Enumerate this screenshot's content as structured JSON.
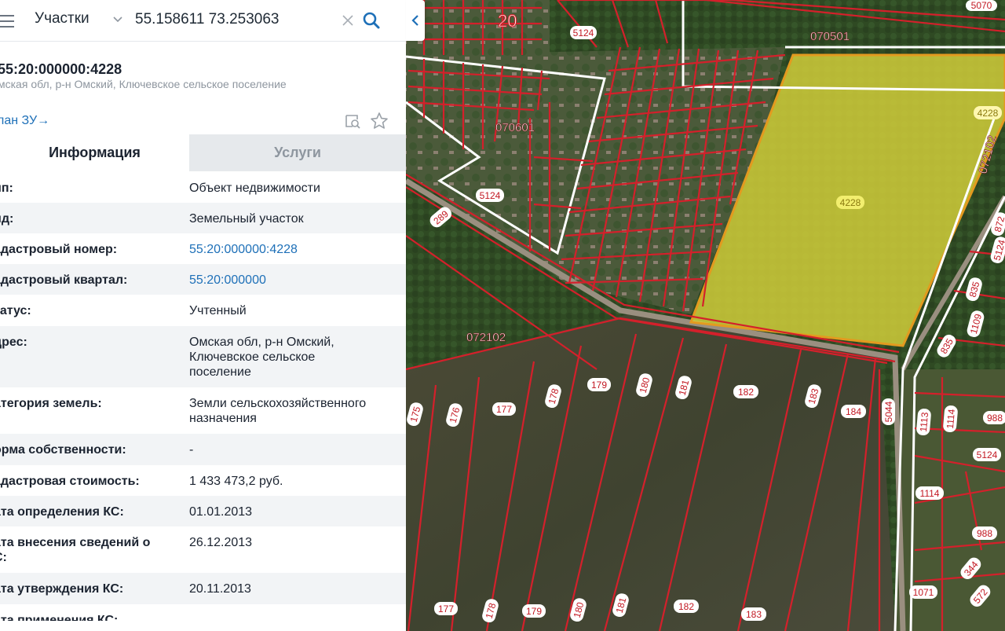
{
  "search": {
    "layer_label": "Участки",
    "query": "55.158611 73.253063"
  },
  "parcel": {
    "number": "55:20:000000:4228",
    "address_short": "мская обл, р-н Омский, Ключевское сельское поселение",
    "plan_link": "лан ЗУ→"
  },
  "tabs": [
    {
      "label": "Информация",
      "active": true
    },
    {
      "label": "Услуги",
      "active": false
    }
  ],
  "info": [
    {
      "key": "ип:",
      "value": [
        "Объект недвижимости"
      ],
      "link": false
    },
    {
      "key": "ид:",
      "value": [
        "Земельный участок"
      ],
      "link": false
    },
    {
      "key": "адастровый номер:",
      "value": [
        "55:20:000000:4228"
      ],
      "link": true
    },
    {
      "key": "адастровый квартал:",
      "value": [
        "55:20:000000"
      ],
      "link": true
    },
    {
      "key": "татус:",
      "value": [
        "Учтенный"
      ],
      "link": false
    },
    {
      "key": "дрес:",
      "value": [
        "Омская обл, р-н Омский,",
        "Ключевское сельское",
        "поселение"
      ],
      "link": false
    },
    {
      "key": "атегория земель:",
      "value": [
        "Земли сельскохозяйственного",
        "назначения"
      ],
      "link": false
    },
    {
      "key": "орма собственности:",
      "value": [
        "-"
      ],
      "link": false
    },
    {
      "key": "адастровая стоимость:",
      "value": [
        "1 433 473,2 руб."
      ],
      "link": false
    },
    {
      "key": "ата определения КС:",
      "value": [
        "01.01.2013"
      ],
      "link": false
    },
    {
      "key": [
        "ата внесения сведений о",
        "С:"
      ],
      "value": [
        "26.12.2013"
      ],
      "link": false
    },
    {
      "key": "ата утверждения КС:",
      "value": [
        "20.11.2013"
      ],
      "link": false
    },
    {
      "key": "ата применения КС:",
      "value": [
        ""
      ],
      "link": false
    }
  ],
  "map": {
    "highlight_color": "#d7d23a",
    "boundary_color": "#d4202b",
    "quarter_labels": [
      "20",
      "070501",
      "070601",
      "072102",
      "072102"
    ],
    "parcel_labels": [
      "5124",
      "5124",
      "289",
      "4228",
      "4228",
      "175",
      "176",
      "177",
      "178",
      "179",
      "180",
      "181",
      "182",
      "183",
      "184",
      "5044",
      "1113",
      "1114",
      "988",
      "5124",
      "1114",
      "988",
      "344",
      "1071",
      "572",
      "835",
      "1109",
      "835",
      "872",
      "5124",
      "177",
      "178",
      "179",
      "180",
      "181",
      "182",
      "183",
      "5070"
    ]
  }
}
